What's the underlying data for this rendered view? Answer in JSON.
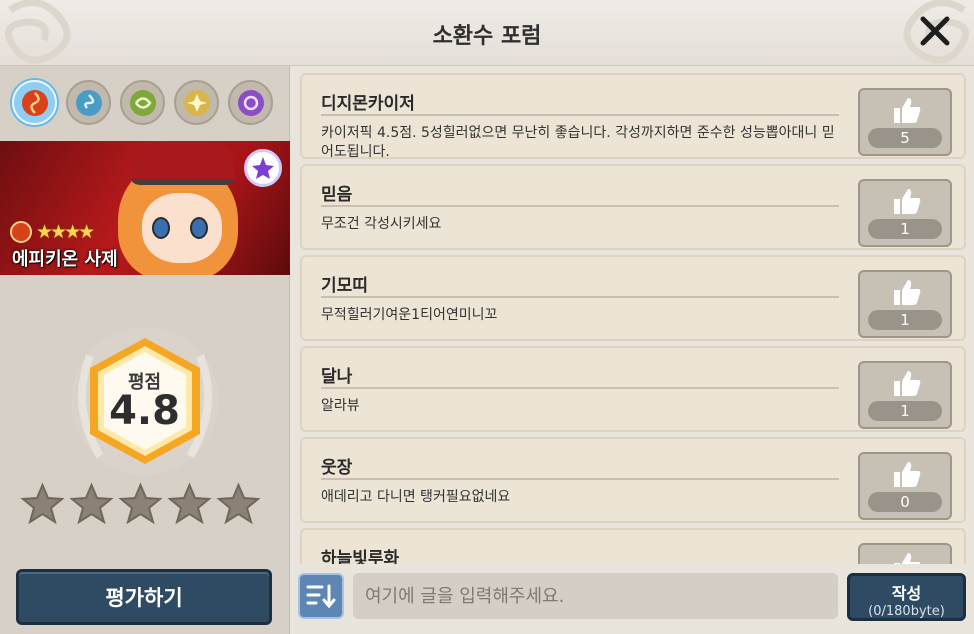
{
  "header": {
    "title": "소환수 포럼"
  },
  "elements": [
    {
      "name": "fire",
      "color": "#d7421b",
      "active": true
    },
    {
      "name": "water",
      "color": "#4a9cc7",
      "active": false
    },
    {
      "name": "wood",
      "color": "#7ea83a",
      "active": false
    },
    {
      "name": "light",
      "color": "#d9b64a",
      "active": false
    },
    {
      "name": "dark",
      "color": "#8a4ec4",
      "active": false
    }
  ],
  "monster": {
    "name": "에피키온 사제",
    "grade": "★★★★",
    "element": "fire"
  },
  "rating": {
    "label": "평점",
    "value": "4.8",
    "stars": 0
  },
  "rate_button": "평가하기",
  "posts": [
    {
      "author": "디지몬카이저",
      "text": "카이저픽 4.5점. 5성힐러없으면 무난히 좋습니다. 각성까지하면 준수한 성능뽑아대니 믿어도됩니다.",
      "likes": "5"
    },
    {
      "author": "믿음",
      "text": "무조건 각성시키세요",
      "likes": "1"
    },
    {
      "author": "기모띠",
      "text": "무적힐러기여운1티어연미니꼬",
      "likes": "1"
    },
    {
      "author": "달나",
      "text": "알라뷰",
      "likes": "1"
    },
    {
      "author": "웃장",
      "text": "애데리고 다니면 탱커필요없네요",
      "likes": "0"
    },
    {
      "author": "하늘빛루화",
      "text": "",
      "likes": ""
    }
  ],
  "composer": {
    "placeholder": "여기에 글을 입력해주세요.",
    "submit_label": "작성",
    "byte_counter": "(0/180byte)"
  }
}
